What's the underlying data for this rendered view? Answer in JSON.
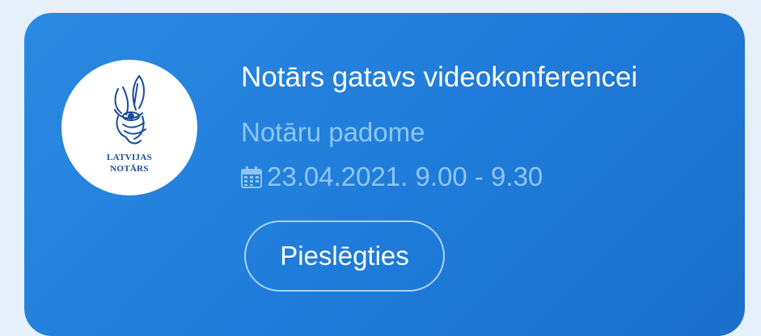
{
  "card": {
    "logo": {
      "line1": "LATVIJAS",
      "line2": "NOTĀRS"
    },
    "title": "Notārs gatavs videokonferencei",
    "organizer": "Notāru padome",
    "datetime": "23.04.2021. 9.00 - 9.30",
    "join_label": "Pieslēgties"
  },
  "colors": {
    "background": "#e6f0fa",
    "card": "#1f7bd9",
    "subtext": "#8ec5f5",
    "logo_text": "#1a4a9a"
  },
  "icons": [
    "latvijas-notars-logo",
    "calendar-icon"
  ]
}
